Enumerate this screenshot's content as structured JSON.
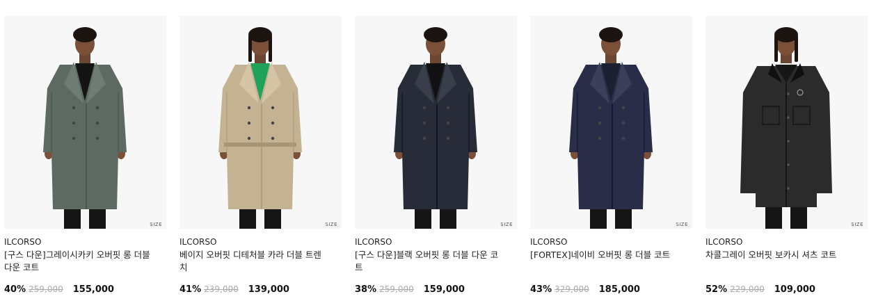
{
  "size_label": "SIZE",
  "products": [
    {
      "brand": "ILCORSO",
      "title": "[구스 다운]그레이시카키 오버핏 롱 더블 다운 코트",
      "discount": "40%",
      "original_price": "259,000",
      "price": "155,000",
      "coat_color": "#5c6a62",
      "inner_color": "#141414",
      "style": "overcoat"
    },
    {
      "brand": "ILCORSO",
      "title": "베이지 오버핏 디테처블 카라 더블 트렌치",
      "discount": "41%",
      "original_price": "239,000",
      "price": "139,000",
      "coat_color": "#c4b393",
      "inner_color": "#1fa35a",
      "style": "trench"
    },
    {
      "brand": "ILCORSO",
      "title": "[구스 다운]블랙 오버핏 롱 더블 다운 코트",
      "discount": "38%",
      "original_price": "259,000",
      "price": "159,000",
      "coat_color": "#272c38",
      "inner_color": "#111111",
      "style": "overcoat"
    },
    {
      "brand": "ILCORSO",
      "title": "[FORTEX]네이비 오버핏 롱 더블 코트",
      "discount": "43%",
      "original_price": "329,000",
      "price": "185,000",
      "coat_color": "#2a2d48",
      "inner_color": "#1d2030",
      "style": "overcoat"
    },
    {
      "brand": "ILCORSO",
      "title": "차콜그레이 오버핏 보카시 셔츠 코트",
      "discount": "52%",
      "original_price": "229,000",
      "price": "109,000",
      "coat_color": "#2b2b2b",
      "inner_color": "#161616",
      "style": "shirt"
    }
  ]
}
